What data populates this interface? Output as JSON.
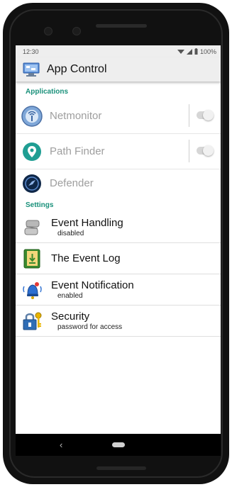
{
  "status": {
    "time": "12:30",
    "battery": "100%"
  },
  "appbar": {
    "title": "App Control",
    "icon": "app-control-icon"
  },
  "sections": {
    "applications": "Applications",
    "settings": "Settings"
  },
  "apps": [
    {
      "label": "Netmonitor",
      "icon": "netmonitor-icon",
      "toggle": false
    },
    {
      "label": "Path Finder",
      "icon": "path-finder-icon",
      "toggle": false
    },
    {
      "label": "Defender",
      "icon": "defender-icon"
    }
  ],
  "settings": [
    {
      "title": "Event Handling",
      "sub": "disabled",
      "icon": "scroll-icon"
    },
    {
      "title": "The Event Log",
      "icon": "log-book-icon"
    },
    {
      "title": "Event Notification",
      "sub": "enabled",
      "icon": "bell-icon"
    },
    {
      "title": "Security",
      "sub": "password for access",
      "icon": "lock-key-icon"
    }
  ],
  "navbar": {
    "back": "‹"
  },
  "colors": {
    "accent": "#19907a",
    "appbar": "#eeeeee",
    "disabled_text": "#9e9e9e"
  }
}
